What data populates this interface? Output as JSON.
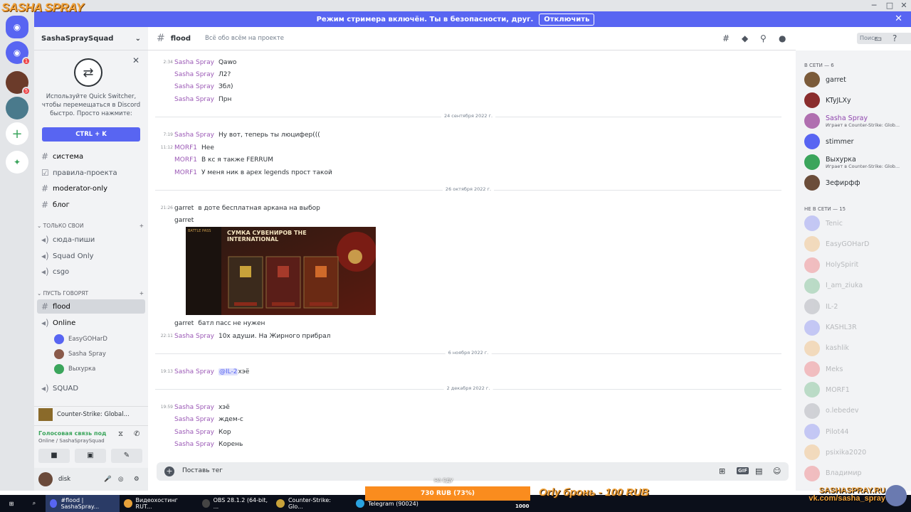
{
  "overlay": {
    "logo": "SASHA SPRAY",
    "donation_label": "730 RUB (73%)",
    "donation_top": "НА ЕДУ",
    "donation_goal": "1000",
    "promo": "Orly бронь - 100 RUB",
    "brand_line1": "SASHASPRAY.RU",
    "brand_line2": "vk.com/sasha_spray"
  },
  "banner": {
    "text": "Режим стримера включён. Ты в безопасности, друг.",
    "button": "Отключить"
  },
  "guild": {
    "name": "SashaSpraySquad"
  },
  "quick_switcher": {
    "text": "Используйте Quick Switcher, чтобы перемещаться в Discord быстро. Просто нажмите:",
    "button": "CTRL + K"
  },
  "channels": {
    "top": [
      "система",
      "правила-проекта",
      "moderator-only",
      "блог"
    ],
    "cat1": "только свои",
    "cat1_items": [
      "сюда-пиши",
      "Squad Only",
      "csgo"
    ],
    "cat2": "пусть говорят",
    "active": "flood",
    "voice_online": "Online",
    "voice_users": [
      "EasyGOHarD",
      "Sasha Spray",
      "Выхурка"
    ],
    "squad": "SQUAD"
  },
  "game_bar": {
    "label": "Counter-Strike: Global..."
  },
  "voice_panel": {
    "status": "Голосовая связь под",
    "sub": "Online / SashaSpraySquad"
  },
  "user_panel": {
    "name": "disk"
  },
  "chat": {
    "channel": "flood",
    "topic": "Всё обо всём на проекте",
    "search": "Поиск",
    "input": "Поставь тег"
  },
  "messages": [
    {
      "ts": "2:34",
      "author": "Sasha Spray",
      "text": "Qawo"
    },
    {
      "ts": "",
      "author": "Sasha Spray",
      "text": "Л2?"
    },
    {
      "ts": "",
      "author": "Sasha Spray",
      "text": "Збл)"
    },
    {
      "ts": "",
      "author": "Sasha Spray",
      "text": "Прн"
    },
    {
      "divider": "24 сентября 2022 г."
    },
    {
      "ts": "7:19",
      "author": "Sasha Spray",
      "text": "Ну вот, теперь ты люцифер((("
    },
    {
      "ts": "11:12",
      "author": "MORF1",
      "text": "Нее"
    },
    {
      "ts": "",
      "author": "MORF1",
      "text": "В кс я также FERRUM"
    },
    {
      "ts": "",
      "author": "MORF1",
      "text": "У меня ник в apex legends прост такой"
    },
    {
      "divider": "26 октября 2022 г."
    },
    {
      "ts": "21:26",
      "author": "garret",
      "text": "в доте бесплатная аркана на выбор"
    },
    {
      "ts": "",
      "author": "garret",
      "text": ""
    },
    {
      "ts": "",
      "author": "garret",
      "text": "батл пасс не нужен"
    },
    {
      "ts": "22:11",
      "author": "Sasha Spray",
      "text": "10х адуши. На Жирного прибрал"
    },
    {
      "divider": "6 ноября 2022 г."
    },
    {
      "ts": "19:13",
      "author": "Sasha Spray",
      "mention": "@IL-2",
      "text": "хэё"
    },
    {
      "divider": "2 декабря 2022 г."
    },
    {
      "ts": "19:59",
      "author": "Sasha Spray",
      "text": "хэё"
    },
    {
      "ts": "",
      "author": "Sasha Spray",
      "text": "ждем-с"
    },
    {
      "ts": "",
      "author": "Sasha Spray",
      "text": "Кор"
    },
    {
      "ts": "",
      "author": "Sasha Spray",
      "text": "Корень"
    }
  ],
  "embed": {
    "tag": "BATTLE PASS",
    "title": "СУМКА СУВЕНИРОВ THE INTERNATIONAL"
  },
  "members": {
    "online_header": "В СЕТИ — 6",
    "offline_header": "НЕ В СЕТИ — 15",
    "online": [
      {
        "name": "garret",
        "color": "#2e3338",
        "av": "#7b5b3a"
      },
      {
        "name": "KTyJLXy",
        "color": "#2e3338",
        "av": "#8a2d2d"
      },
      {
        "name": "Sasha Spray",
        "color": "#8e44ad",
        "av": "#b06fb0",
        "activity": "Играет в Counter-Strike: Glob..."
      },
      {
        "name": "stimmer",
        "color": "#2e3338",
        "av": "#5865f2"
      },
      {
        "name": "Выхурка",
        "color": "#2e3338",
        "av": "#3ba55c",
        "activity": "Играет в Counter-Strike: Glob..."
      },
      {
        "name": "Зефирфф",
        "color": "#2e3338",
        "av": "#6b4d3a"
      }
    ],
    "offline": [
      "Tenic",
      "EasyGOHarD",
      "HolySpirit",
      "I_am_ziuka",
      "IL-2",
      "KASHL3R",
      "kashlik",
      "Meks",
      "MORF1",
      "o.lebedev",
      "Pilot44",
      "psixika2020",
      "Владимир"
    ]
  },
  "taskbar": [
    "#flood | SashaSpray...",
    "Видеохостинг RUT...",
    "OBS 28.1.2 (64-bit, ...",
    "Counter-Strike: Glo...",
    "Telegram (90024)"
  ],
  "colors": {
    "blurple": "#5865f2",
    "author_purple": "#9b59b6",
    "orange": "#fa8c1e"
  }
}
